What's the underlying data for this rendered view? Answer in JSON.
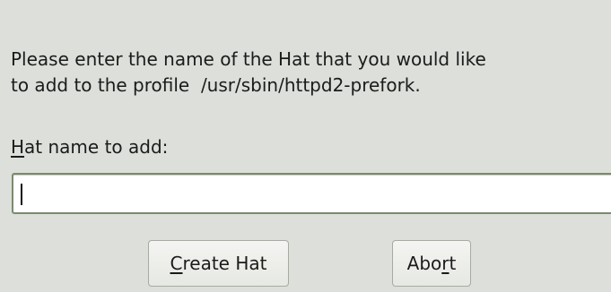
{
  "dialog": {
    "message_line1": "Please enter the name of the Hat that you would like",
    "message_line2": "to add to the profile  /usr/sbin/httpd2-prefork.",
    "label_mnemonic": "H",
    "label_rest": "at name to add:",
    "input_value": ""
  },
  "buttons": {
    "create_mnemonic": "C",
    "create_rest": "reate Hat",
    "abort_pre": "Abo",
    "abort_mnemonic": "r",
    "abort_post": "t"
  }
}
